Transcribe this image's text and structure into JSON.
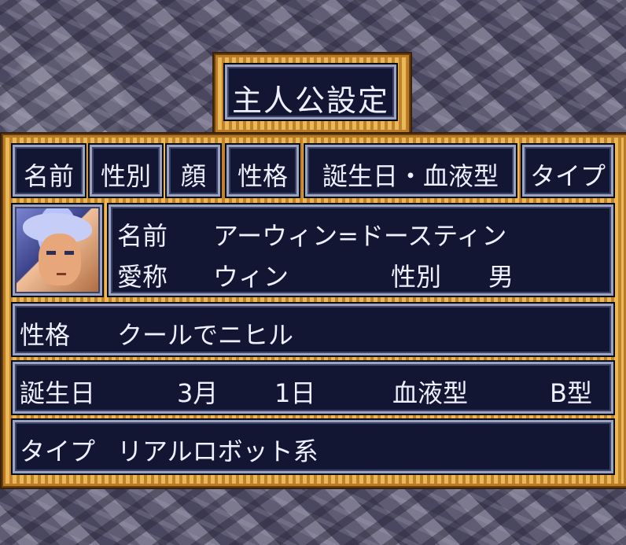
{
  "title": "主人公設定",
  "tabs": [
    "名前",
    "性別",
    "顔",
    "性格",
    "誕生日・血液型",
    "タイプ"
  ],
  "profile": {
    "name_label": "名前",
    "name_value": "アーウィン=ドースティン",
    "nickname_label": "愛称",
    "nickname_value": "ウィン",
    "gender_label": "性別",
    "gender_value": "男"
  },
  "personality": {
    "label": "性格",
    "value": "クールでニヒル"
  },
  "birthday": {
    "label": "誕生日",
    "month": "3月",
    "day": "1日",
    "blood_label": "血液型",
    "blood_value": "B型"
  },
  "type": {
    "label": "タイプ",
    "value": "リアルロボット系"
  },
  "colors": {
    "panel": "#121633",
    "border": "#9aa3c2",
    "gold": "#e0a640"
  }
}
